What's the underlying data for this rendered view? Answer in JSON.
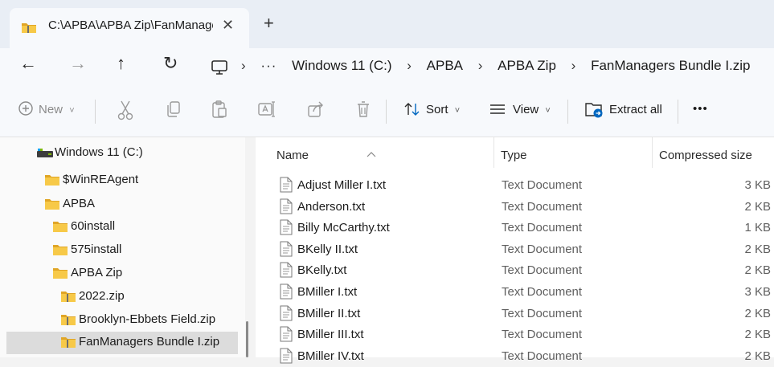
{
  "tab": {
    "title": "C:\\APBA\\APBA Zip\\FanManagers Bundle I.zip",
    "close_glyph": "✕",
    "add_glyph": "+",
    "icon": "folder-zip-icon"
  },
  "nav": {
    "back": "←",
    "forward": "→",
    "up": "↑",
    "refresh": "↻"
  },
  "breadcrumb": {
    "more": "···",
    "separator": "›",
    "items": [
      "Windows 11 (C:)",
      "APBA",
      "APBA Zip",
      "FanManagers Bundle I.zip"
    ]
  },
  "commandbar": {
    "new_label": "New",
    "sort_label": "Sort",
    "view_label": "View",
    "extract_label": "Extract all",
    "more_label": "•••",
    "chevron": "˅"
  },
  "tree": [
    {
      "label": "Windows 11 (C:)",
      "icon": "drive-icon"
    },
    {
      "label": "$WinREAgent",
      "icon": "folder-icon"
    },
    {
      "label": "APBA",
      "icon": "folder-icon"
    },
    {
      "label": "60install",
      "icon": "folder-icon"
    },
    {
      "label": "575install",
      "icon": "folder-icon"
    },
    {
      "label": "APBA Zip",
      "icon": "folder-icon"
    },
    {
      "label": "2022.zip",
      "icon": "zip-folder-icon"
    },
    {
      "label": "Brooklyn-Ebbets Field.zip",
      "icon": "zip-folder-icon"
    },
    {
      "label": "FanManagers Bundle I.zip",
      "icon": "zip-folder-icon",
      "selected": true
    }
  ],
  "columns": {
    "name": "Name",
    "type": "Type",
    "compressed_size": "Compressed size"
  },
  "files": [
    {
      "name": "Adjust Miller I.txt",
      "type": "Text Document",
      "size": "3 KB"
    },
    {
      "name": "Anderson.txt",
      "type": "Text Document",
      "size": "2 KB"
    },
    {
      "name": "Billy McCarthy.txt",
      "type": "Text Document",
      "size": "1 KB"
    },
    {
      "name": "BKelly II.txt",
      "type": "Text Document",
      "size": "2 KB"
    },
    {
      "name": "BKelly.txt",
      "type": "Text Document",
      "size": "2 KB"
    },
    {
      "name": "BMiller I.txt",
      "type": "Text Document",
      "size": "3 KB"
    },
    {
      "name": "BMiller II.txt",
      "type": "Text Document",
      "size": "2 KB"
    },
    {
      "name": "BMiller III.txt",
      "type": "Text Document",
      "size": "2 KB"
    },
    {
      "name": "BMiller IV.txt",
      "type": "Text Document",
      "size": "2 KB"
    }
  ],
  "colors": {
    "folder": "#f2c14e",
    "folder_dark": "#e0a526",
    "accent": "#0067c0",
    "selected_bg": "#dcdcdc"
  }
}
